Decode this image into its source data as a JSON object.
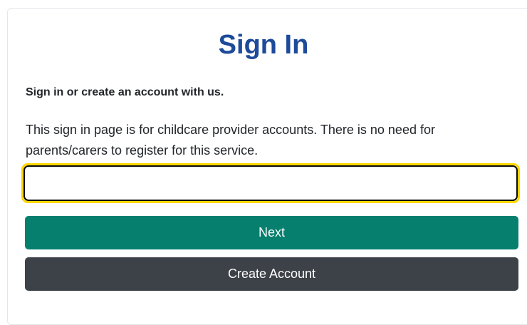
{
  "page": {
    "title": "Sign In",
    "subheading": "Sign in or create an account with us.",
    "description": "This sign in page is for childcare provider accounts. There is no need for parents/carers to register for this service."
  },
  "form": {
    "email_value": "",
    "next_label": "Next",
    "create_account_label": "Create Account"
  },
  "colors": {
    "title": "#1d4a9a",
    "next_button": "#067f6e",
    "create_button": "#3d4148",
    "focus_ring": "#ffd600"
  }
}
